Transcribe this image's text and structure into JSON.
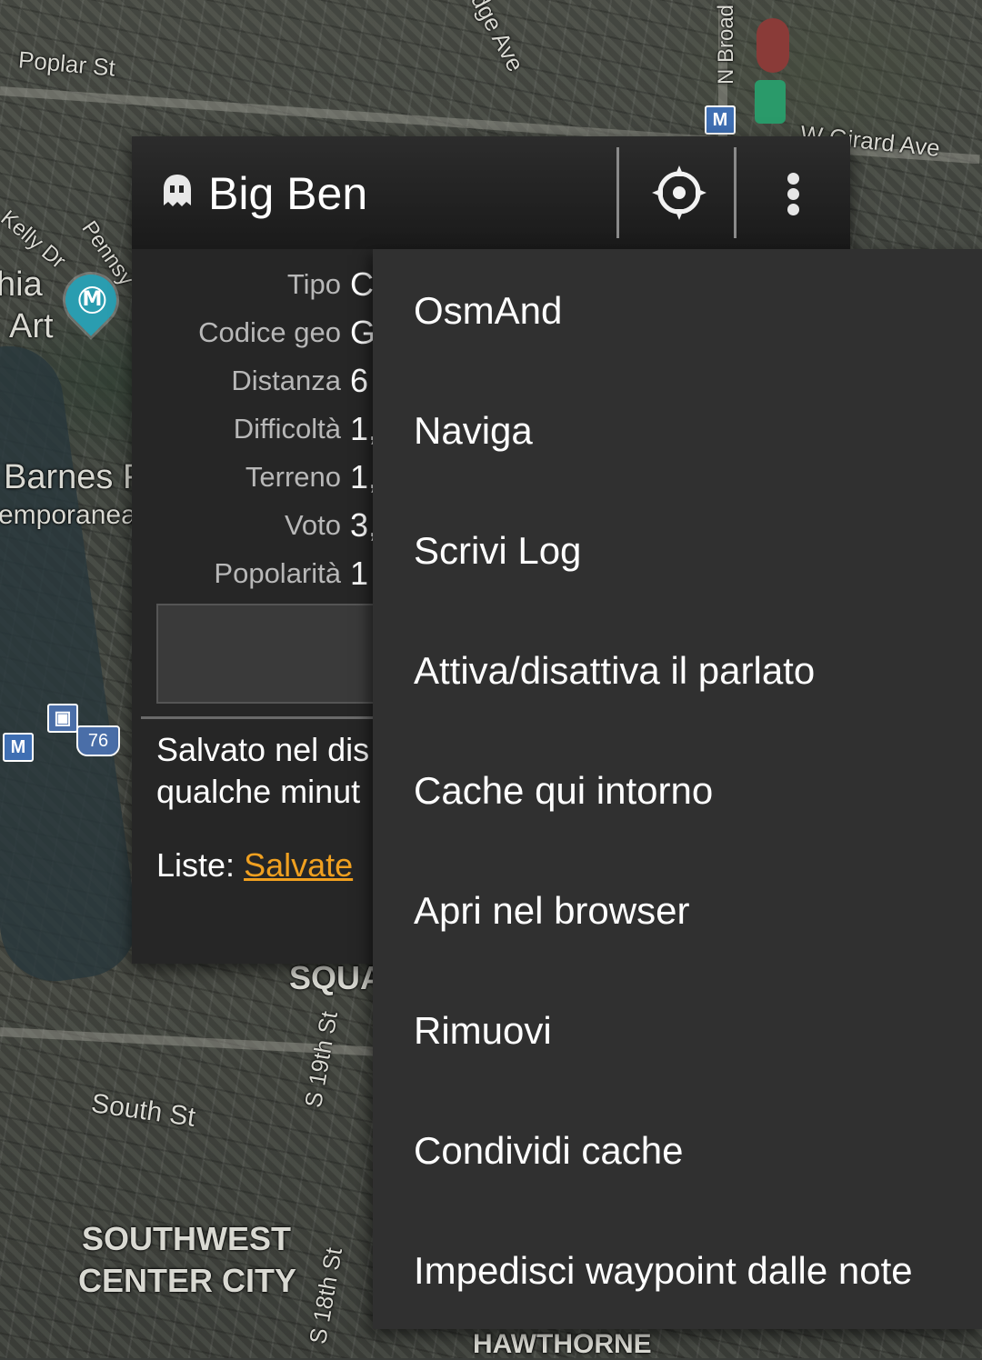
{
  "map": {
    "labels": {
      "poplar": "Poplar St",
      "girard": "W Girard Ave",
      "ridge": "dge Ave",
      "broad": "N Broad",
      "kelly": "Kelly Dr",
      "penn": "Pennsy",
      "museum1": "hia",
      "museum2": "Art",
      "barnes": "Barnes F",
      "contemporanea": "emporanea",
      "south": "South St",
      "squa": "SQUA",
      "s19": "S 19th St",
      "s18": "S 18th St",
      "sw1": "SOUTHWEST",
      "sw2": "CENTER CITY",
      "hawthorne": "HAWTHORNE",
      "route": "76",
      "metro": "M"
    }
  },
  "cache": {
    "title": "Big Ben",
    "details": [
      {
        "label": "Tipo",
        "value": "C"
      },
      {
        "label": "Codice geo",
        "value": "G"
      },
      {
        "label": "Distanza",
        "value": "6"
      },
      {
        "label": "Difficoltà",
        "value": "1,"
      },
      {
        "label": "Terreno",
        "value": "1,"
      },
      {
        "label": "Voto",
        "value": "3,"
      },
      {
        "label": "Popolarità",
        "value": "1"
      }
    ],
    "saved_line1": "Salvato nel dis",
    "saved_line2": "qualche minut",
    "lists_label": "Liste:",
    "lists_link": "Salvate"
  },
  "menu": {
    "items": [
      "OsmAnd",
      "Naviga",
      "Scrivi Log",
      "Attiva/disattiva il parlato",
      "Cache qui intorno",
      "Apri nel browser",
      "Rimuovi",
      "Condividi cache",
      "Impedisci waypoint dalle note"
    ]
  },
  "icons": {
    "ghost": "ghost-cache-icon",
    "target": "compass-target-icon",
    "overflow": "more-vert-icon"
  },
  "colors": {
    "link": "#f0a020",
    "menu_bg": "#303030",
    "popup_bg": "#262626"
  }
}
